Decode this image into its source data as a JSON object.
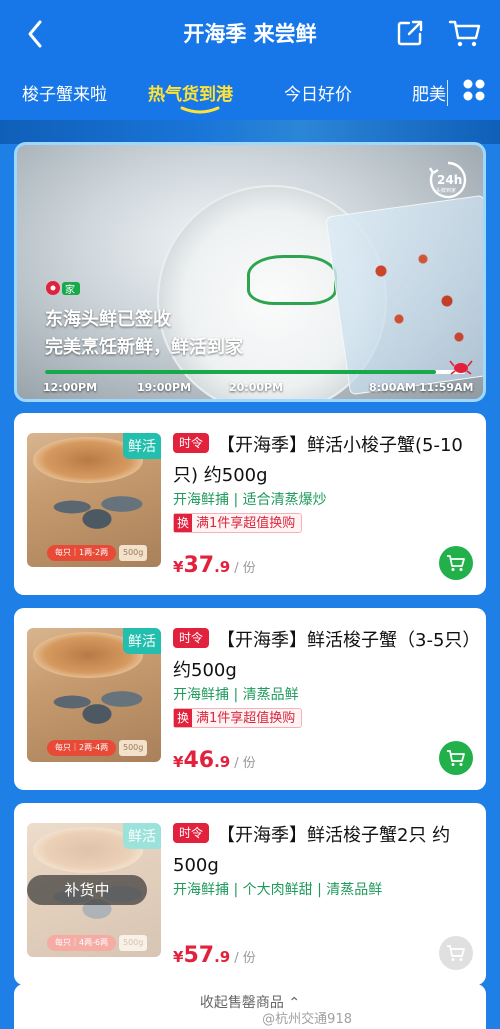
{
  "header": {
    "title": "开海季 来尝鲜"
  },
  "tabs": [
    {
      "label": "梭子蟹来啦"
    },
    {
      "label": "热气货到港"
    },
    {
      "label": "今日好价"
    },
    {
      "label": "肥美"
    }
  ],
  "banner": {
    "line1": "东海头鲜已签收",
    "line2": "完美烹饪新鲜，鲜活到家",
    "pin_label": "家",
    "badge_24h": "24h",
    "badge_sub": "头鲜到家",
    "progress": 0.93,
    "times": [
      "12:00PM",
      "19:00PM",
      "20:00PM",
      "8:00AM",
      "11:59AM"
    ]
  },
  "products": [
    {
      "title": "【开海季】鲜活小梭子蟹(5-10只) 约500g",
      "time_badge": "时令",
      "fresh_tag": "鲜活",
      "subtitle": "开海鲜捕 | 适合清蒸爆炒",
      "promo_icon": "换",
      "promo": "满1件享超值换购",
      "currency": "¥",
      "price_int": "37",
      "price_dec": ".9",
      "unit": "/ 份",
      "thumb_note": "每只｜1两-2两",
      "thumb_weight": "500g",
      "restock": "",
      "in_stock": true
    },
    {
      "title": "【开海季】鲜活梭子蟹（3-5只）约500g",
      "time_badge": "时令",
      "fresh_tag": "鲜活",
      "subtitle": "开海鲜捕 | 清蒸品鲜",
      "promo_icon": "换",
      "promo": "满1件享超值换购",
      "currency": "¥",
      "price_int": "46",
      "price_dec": ".9",
      "unit": "/ 份",
      "thumb_note": "每只｜2两-4两",
      "thumb_weight": "500g",
      "restock": "",
      "in_stock": true
    },
    {
      "title": "【开海季】鲜活梭子蟹2只 约500g",
      "time_badge": "时令",
      "fresh_tag": "鲜活",
      "subtitle": "开海鲜捕 | 个大肉鲜甜 | 清蒸品鲜",
      "promo_icon": "",
      "promo": "",
      "currency": "¥",
      "price_int": "57",
      "price_dec": ".9",
      "unit": "/ 份",
      "thumb_note": "每只｜4两-6两",
      "thumb_weight": "500g",
      "restock": "补货中",
      "in_stock": false
    }
  ],
  "footer": {
    "collapse_label": "收起售罄商品 ⌃"
  },
  "watermark": "@杭州交通918",
  "colors": {
    "brand_blue": "#1877e8",
    "active_tab": "#ffe437",
    "price_red": "#e2213d",
    "cart_green": "#22b04a"
  }
}
